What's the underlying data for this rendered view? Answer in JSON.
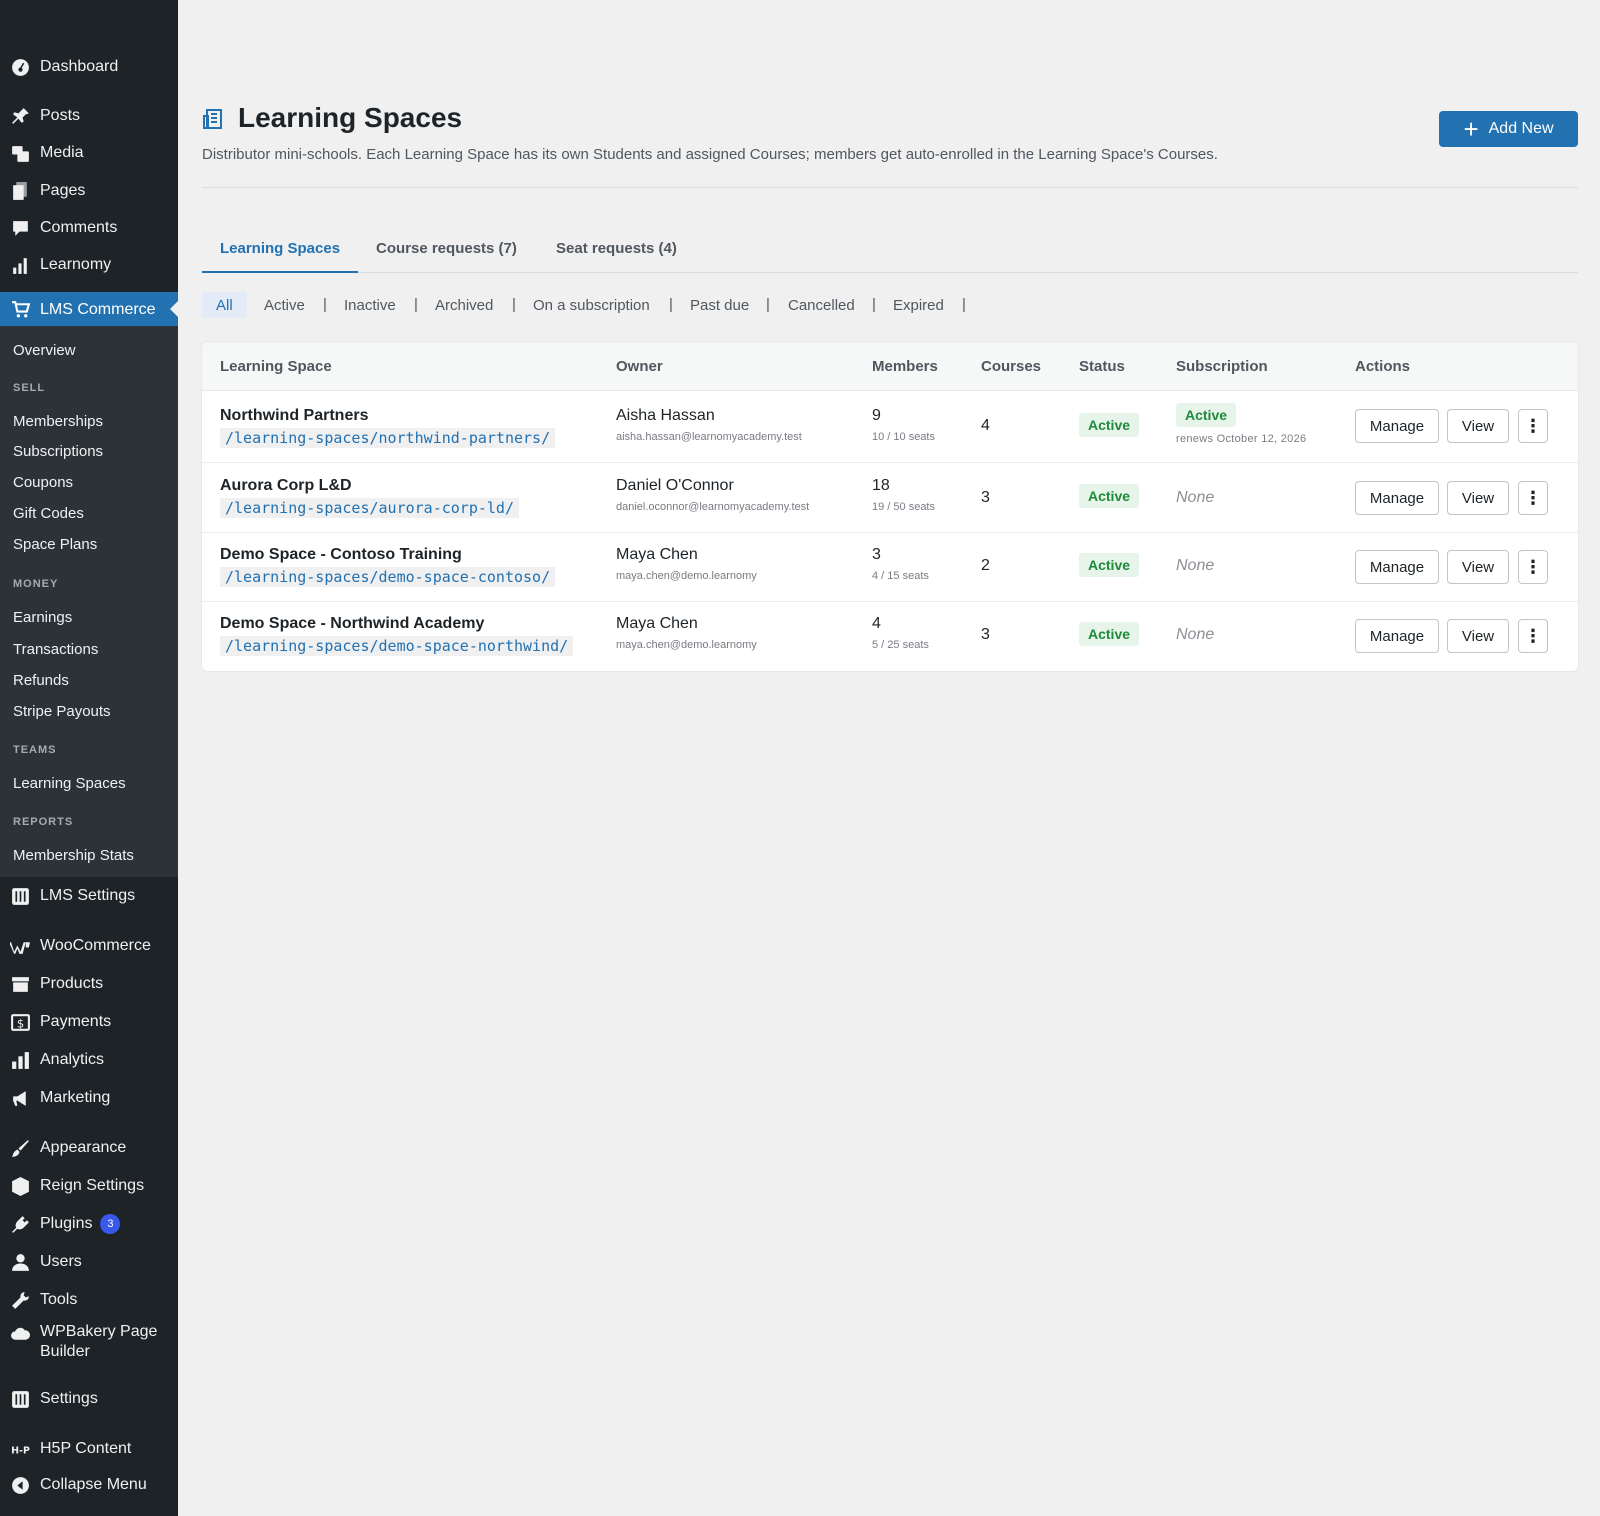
{
  "sidebar": {
    "top_items": [
      {
        "label": "Dashboard",
        "icon": "dashboard-icon"
      },
      {
        "label": "Posts",
        "icon": "pin-icon"
      },
      {
        "label": "Media",
        "icon": "media-icon"
      },
      {
        "label": "Pages",
        "icon": "pages-icon"
      },
      {
        "label": "Comments",
        "icon": "comment-icon"
      },
      {
        "label": "Learnomy",
        "icon": "chart-icon"
      },
      {
        "label": "LMS Commerce",
        "icon": "cart-icon"
      }
    ],
    "submenu": {
      "overview": "Overview",
      "sell_heading": "SELL",
      "sell": [
        "Memberships",
        "Subscriptions",
        "Coupons",
        "Gift Codes",
        "Space Plans"
      ],
      "money_heading": "MONEY",
      "money": [
        "Earnings",
        "Transactions",
        "Refunds",
        "Stripe Payouts"
      ],
      "teams_heading": "TEAMS",
      "teams": [
        "Learning Spaces"
      ],
      "reports_heading": "REPORTS",
      "reports": [
        "Membership Stats"
      ]
    },
    "bottom_items": [
      {
        "label": "LMS Settings",
        "icon": "settings-grid-icon"
      },
      {
        "label": "WooCommerce",
        "icon": "woo-icon"
      },
      {
        "label": "Products",
        "icon": "archive-icon"
      },
      {
        "label": "Payments",
        "icon": "dollar-icon"
      },
      {
        "label": "Analytics",
        "icon": "bar-chart-icon"
      },
      {
        "label": "Marketing",
        "icon": "megaphone-icon"
      },
      {
        "label": "Appearance",
        "icon": "brush-icon"
      },
      {
        "label": "Reign Settings",
        "icon": "cube-icon"
      },
      {
        "label": "Plugins",
        "icon": "plug-icon",
        "badge": "3"
      },
      {
        "label": "Users",
        "icon": "user-icon"
      },
      {
        "label": "Tools",
        "icon": "wrench-icon"
      },
      {
        "label": "WPBakery Page Builder",
        "icon": "cloud-icon"
      },
      {
        "label": "Settings",
        "icon": "settings-grid-icon"
      },
      {
        "label": "H5P Content",
        "icon": "h5p-icon"
      },
      {
        "label": "Collapse Menu",
        "icon": "collapse-icon"
      }
    ]
  },
  "header": {
    "title": "Learning Spaces",
    "description": "Distributor mini-schools. Each Learning Space has its own Students and assigned Courses; members get auto-enrolled in the Learning Space's Courses.",
    "add_new": "Add New"
  },
  "tabs": [
    "Learning Spaces",
    "Course requests (7)",
    "Seat requests (4)"
  ],
  "filters": [
    "All",
    "Active",
    "Inactive",
    "Archived",
    "On a subscription",
    "Past due",
    "Cancelled",
    "Expired"
  ],
  "filter_separator": "|",
  "table": {
    "columns": [
      "Learning Space",
      "Owner",
      "Members",
      "Courses",
      "Status",
      "Subscription",
      "Actions"
    ],
    "rows": [
      {
        "name": "Northwind Partners",
        "url": "/learning-spaces/northwind-partners/",
        "owner": "Aisha Hassan",
        "email": "aisha.hassan@learnomyacademy.test",
        "members": "9",
        "seats": "10 / 10 seats",
        "courses": "4",
        "status": "Active",
        "subscription": "Active",
        "renews": "renews October 12, 2026"
      },
      {
        "name": "Aurora Corp L&D",
        "url": "/learning-spaces/aurora-corp-ld/",
        "owner": "Daniel O'Connor",
        "email": "daniel.oconnor@learnomyacademy.test",
        "members": "18",
        "seats": "19 / 50 seats",
        "courses": "3",
        "status": "Active",
        "subscription": "None"
      },
      {
        "name": "Demo Space - Contoso Training",
        "url": "/learning-spaces/demo-space-contoso/",
        "owner": "Maya Chen",
        "email": "maya.chen@demo.learnomy",
        "members": "3",
        "seats": "4 / 15 seats",
        "courses": "2",
        "status": "Active",
        "subscription": "None"
      },
      {
        "name": "Demo Space - Northwind Academy",
        "url": "/learning-spaces/demo-space-northwind/",
        "owner": "Maya Chen",
        "email": "maya.chen@demo.learnomy",
        "members": "4",
        "seats": "5 / 25 seats",
        "courses": "3",
        "status": "Active",
        "subscription": "None"
      }
    ],
    "actions": {
      "manage": "Manage",
      "view": "View",
      "more": "⋮"
    }
  },
  "colors": {
    "accent": "#2271b1",
    "sidebar_bg": "#1d2327",
    "submenu_bg": "#2c3338",
    "success": "#1e8a3a",
    "badge": "#3858e9"
  }
}
